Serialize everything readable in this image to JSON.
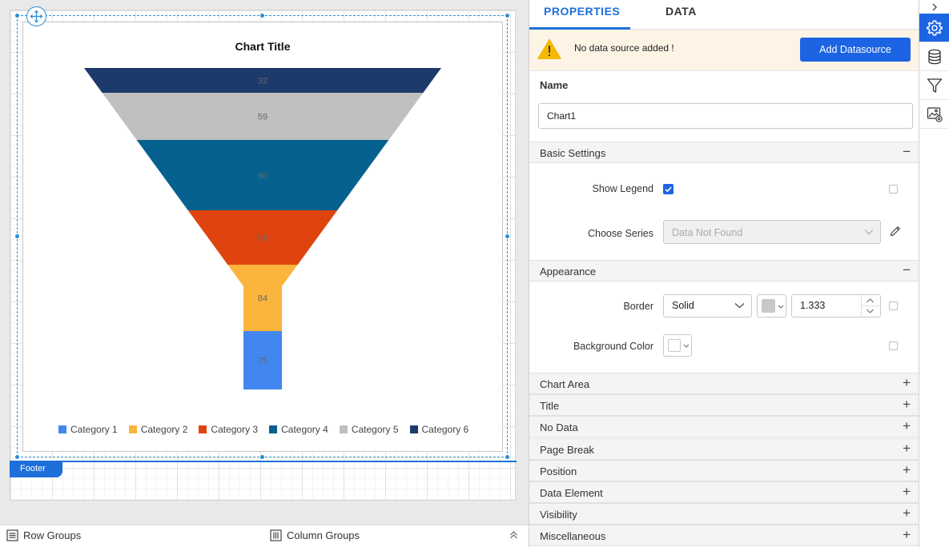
{
  "chart": {
    "title": "Chart Title",
    "segments": [
      {
        "label": "32",
        "color": "#1c3a6b"
      },
      {
        "label": "59",
        "color": "#c0c0c0"
      },
      {
        "label": "90",
        "color": "#07618f"
      },
      {
        "label": "69",
        "color": "#e0440e"
      },
      {
        "label": "84",
        "color": "#fbb53c"
      },
      {
        "label": "75",
        "color": "#4287ef"
      }
    ],
    "legend": [
      {
        "label": "Category 1",
        "color": "#4287ef"
      },
      {
        "label": "Category 2",
        "color": "#fbb53c"
      },
      {
        "label": "Category 3",
        "color": "#e0440e"
      },
      {
        "label": "Category 4",
        "color": "#07618f"
      },
      {
        "label": "Category 5",
        "color": "#c0c0c0"
      },
      {
        "label": "Category 6",
        "color": "#1c3a6b"
      }
    ]
  },
  "footer": {
    "label": "Footer"
  },
  "bottom_bar": {
    "row_groups": "Row Groups",
    "column_groups": "Column Groups"
  },
  "properties": {
    "tabs": {
      "properties": "PROPERTIES",
      "data": "DATA"
    },
    "warning": {
      "text": "No data source added !",
      "button": "Add Datasource"
    },
    "name": {
      "label": "Name",
      "value": "Chart1"
    },
    "basic_settings": {
      "title": "Basic Settings",
      "show_legend_label": "Show Legend",
      "show_legend": true,
      "choose_series_label": "Choose Series",
      "choose_series_value": "Data Not Found"
    },
    "appearance": {
      "title": "Appearance",
      "border_label": "Border",
      "border_style": "Solid",
      "border_width": "1.333",
      "background_color_label": "Background Color"
    },
    "sections": [
      "Chart Area",
      "Title",
      "No Data",
      "Page Break",
      "Position",
      "Data Element",
      "Visibility",
      "Miscellaneous"
    ]
  },
  "icons": {
    "strip": [
      "chevron-right-icon",
      "gear-icon",
      "database-icon",
      "filter-icon",
      "image-settings-icon"
    ]
  }
}
